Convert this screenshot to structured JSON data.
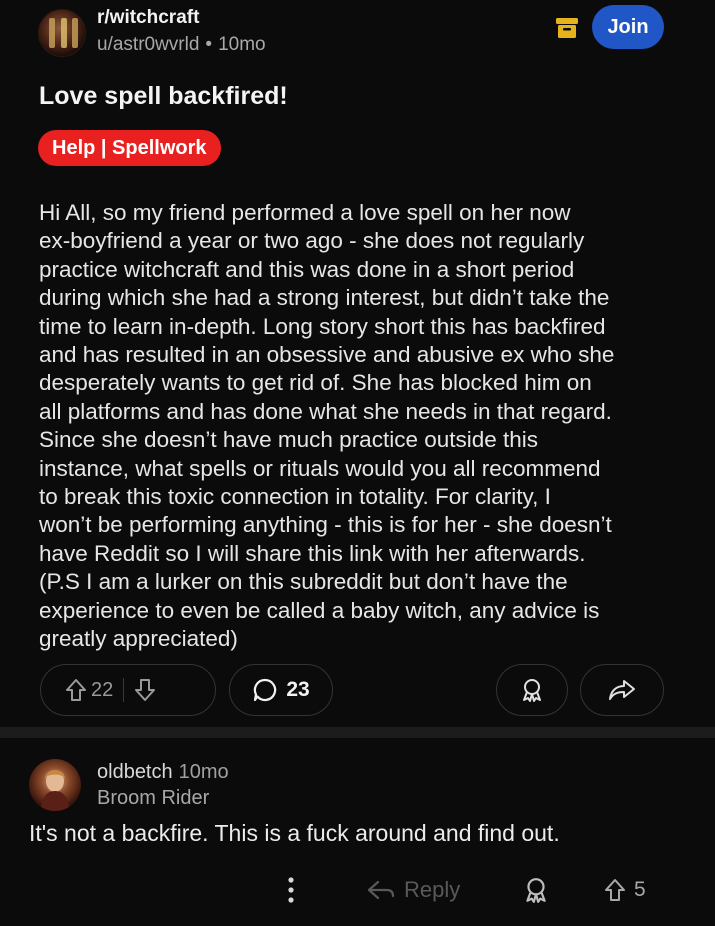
{
  "post": {
    "subreddit": "r/witchcraft",
    "author": "u/astr0wvrld",
    "separator": "•",
    "age": "10mo",
    "join_label": "Join",
    "title": "Love spell backfired!",
    "flair": "Help | Spellwork",
    "body": "Hi All, so my friend performed a love spell on her now\nex-boyfriend a year or two ago - she does not regularly\npractice witchcraft and this was done in a short period\nduring which she had a strong interest, but didn’t take the\ntime to learn in-depth. Long story short this has backfired\nand has resulted in an obsessive and abusive ex who she\ndesperately wants to get rid of. She has blocked him on\nall platforms and has done what she needs in that regard.\nSince she doesn’t have much practice outside this\ninstance, what spells or rituals would you all recommend\nto break this toxic connection in totality. For clarity, I\nwon’t be performing anything - this is for her - she doesn’t\nhave Reddit so I will share this link with her afterwards.\n(P.S I am a lurker on this subreddit but don’t have the\nexperience to even be called a baby witch, any advice is\ngreatly appreciated)",
    "votes": "22",
    "comments": "23"
  },
  "comment": {
    "author": "oldbetch",
    "age": "10mo",
    "flair": "Broom Rider",
    "text": "It's not a backfire. This is a fuck around and find out.",
    "reply_label": "Reply",
    "votes": "5"
  },
  "icons": {
    "header": [
      "archive-icon"
    ],
    "actions": [
      "upvote-icon",
      "downvote-icon",
      "comment-icon",
      "award-icon",
      "share-icon"
    ],
    "comment_actions": [
      "more-icon",
      "reply-icon",
      "award-icon",
      "upvote-icon"
    ]
  },
  "colors": {
    "background": "#0b0b0b",
    "join_button": "#2156c7",
    "flair": "#e8201f",
    "archive_icon": "#e7b31c"
  }
}
